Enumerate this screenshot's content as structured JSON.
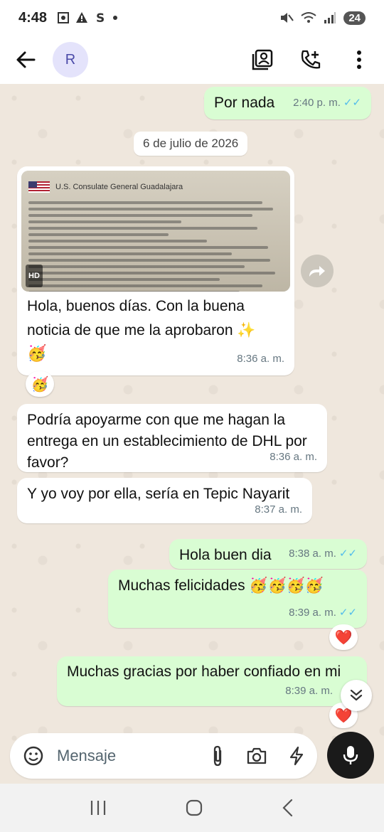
{
  "status_bar": {
    "time": "4:48",
    "battery": "24"
  },
  "header": {
    "avatar_letter": "R"
  },
  "date_divider": "6 de julio de 2026",
  "image_message": {
    "doc_title": "U.S. Consulate General Guadalajara",
    "hd_badge": "HD"
  },
  "messages": [
    {
      "id": "m1",
      "text": "Por nada",
      "time": "2:40 p. m."
    },
    {
      "id": "m2",
      "text": "Hola, buenos días. Con la buena noticia de que me la aprobaron ✨",
      "emoji_line": "🥳",
      "time": "8:36 a. m.",
      "reaction": "🥳"
    },
    {
      "id": "m3",
      "text": "Podría apoyarme con que me hagan la entrega en un establecimiento de DHL por favor?",
      "time": "8:36 a. m."
    },
    {
      "id": "m4",
      "text": "Y yo voy por ella, sería en Tepic Nayarit",
      "time": "8:37 a. m."
    },
    {
      "id": "m5",
      "text": "Hola buen dia",
      "time": "8:38 a. m."
    },
    {
      "id": "m6",
      "text": "Muchas felicidades 🥳🥳🥳🥳",
      "time": "8:39 a. m.",
      "reaction": "❤️"
    },
    {
      "id": "m7",
      "text": "Muchas gracias por haber confiado en mi",
      "time": "8:39 a. m.",
      "reaction": "❤️"
    }
  ],
  "ticks": "✓✓",
  "composer": {
    "placeholder": "Mensaje"
  },
  "icons": {
    "back": "arrow-left-icon",
    "contact_card": "contact-card-icon",
    "add_call": "add-call-icon",
    "more": "more-vertical-icon",
    "emoji": "emoji-icon",
    "attach": "paperclip-icon",
    "camera": "camera-icon",
    "quick": "lightning-icon",
    "mic": "microphone-icon",
    "forward": "forward-icon",
    "scroll_down": "double-chevron-down-icon"
  },
  "colors": {
    "outgoing": "#d9fdd3",
    "incoming": "#ffffff",
    "read_ticks": "#53bdeb",
    "background": "#efe7dd"
  }
}
